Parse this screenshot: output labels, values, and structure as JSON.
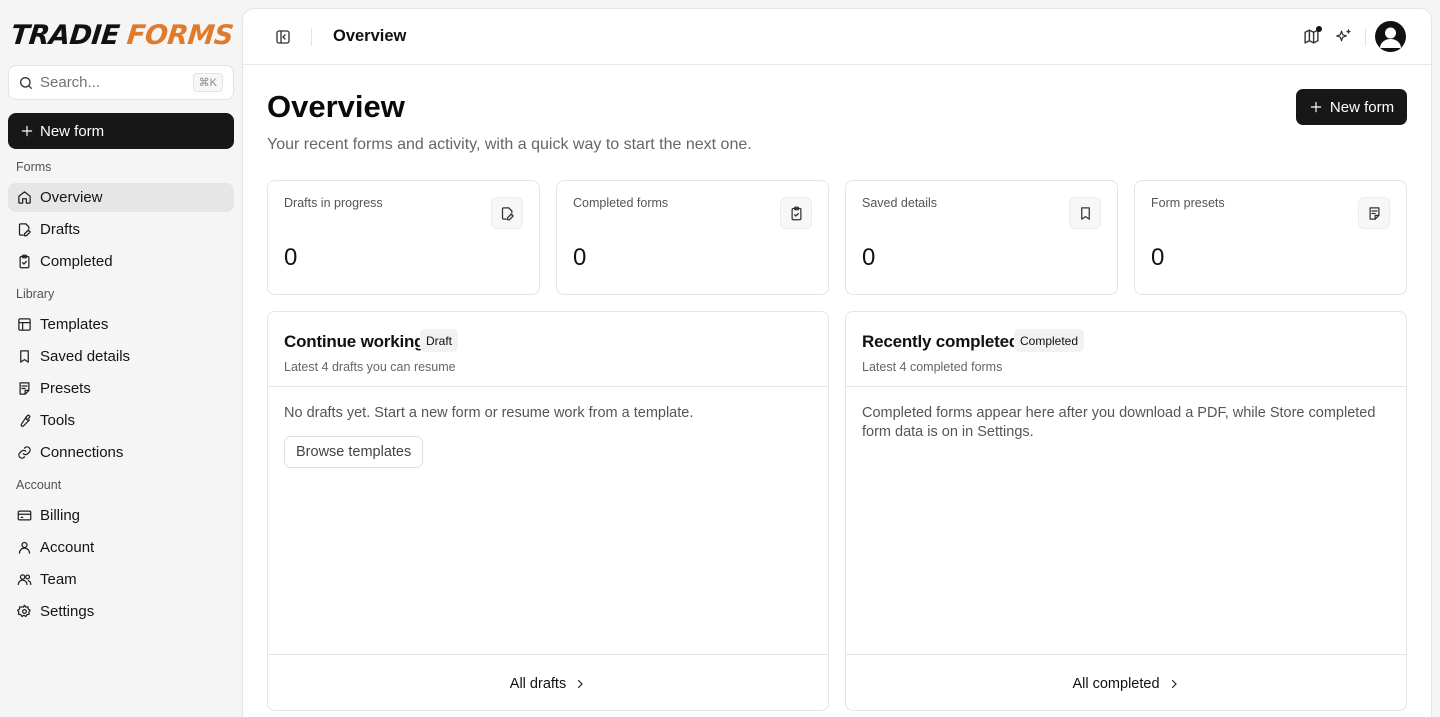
{
  "brand": {
    "word1": "TRADIE",
    "word2": "FORMS",
    "accent_color": "#e07a2c"
  },
  "search": {
    "placeholder": "Search...",
    "shortcut": "⌘K",
    "icon": "search-icon"
  },
  "sidebar": {
    "new_form_label": "New form",
    "groups": [
      {
        "label": "Forms",
        "items": [
          {
            "label": "Overview",
            "icon": "home-icon",
            "active": true
          },
          {
            "label": "Drafts",
            "icon": "file-edit-icon"
          },
          {
            "label": "Completed",
            "icon": "clipboard-check-icon"
          }
        ]
      },
      {
        "label": "Library",
        "items": [
          {
            "label": "Templates",
            "icon": "layout-icon"
          },
          {
            "label": "Saved details",
            "icon": "bookmark-icon"
          },
          {
            "label": "Presets",
            "icon": "notepad-icon"
          },
          {
            "label": "Tools",
            "icon": "wrench-icon"
          },
          {
            "label": "Connections",
            "icon": "link-icon"
          }
        ]
      },
      {
        "label": "Account",
        "items": [
          {
            "label": "Billing",
            "icon": "credit-card-icon"
          },
          {
            "label": "Account",
            "icon": "user-icon"
          },
          {
            "label": "Team",
            "icon": "users-icon"
          },
          {
            "label": "Settings",
            "icon": "gear-icon"
          }
        ]
      }
    ]
  },
  "header": {
    "title": "Overview"
  },
  "main": {
    "title": "Overview",
    "subtitle": "Your recent forms and activity, with a quick way to start the next one.",
    "new_form_label": "New form",
    "stats": [
      {
        "label": "Drafts in progress",
        "value": "0",
        "icon": "file-edit-icon"
      },
      {
        "label": "Completed forms",
        "value": "0",
        "icon": "clipboard-check-icon"
      },
      {
        "label": "Saved details",
        "value": "0",
        "icon": "bookmark-icon"
      },
      {
        "label": "Form presets",
        "value": "0",
        "icon": "notepad-icon"
      }
    ],
    "continue_panel": {
      "title": "Continue working",
      "badge": "Draft",
      "subtitle": "Latest 4 drafts you can resume",
      "empty_text": "No drafts yet. Start a new form or resume work from a template.",
      "button": "Browse templates",
      "footer_link": "All drafts"
    },
    "completed_panel": {
      "title": "Recently completed",
      "badge": "Completed",
      "subtitle": "Latest 4 completed forms",
      "empty_text": "Completed forms appear here after you download a PDF, while Store completed form data is on in Settings.",
      "footer_link": "All completed"
    }
  }
}
